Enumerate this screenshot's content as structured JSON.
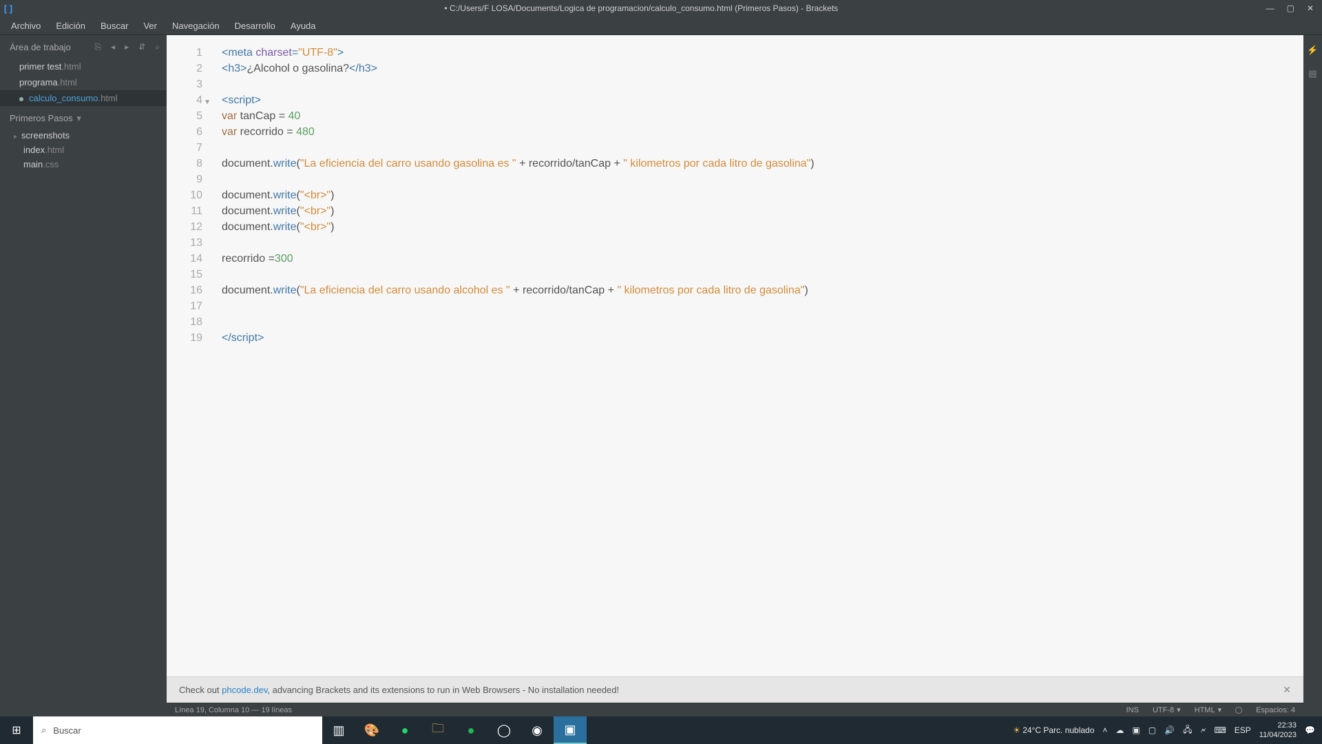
{
  "window": {
    "title": "• C:/Users/F LOSA/Documents/Logica de programacion/calculo_consumo.html (Primeros Pasos) - Brackets"
  },
  "menu": {
    "items": [
      "Archivo",
      "Edición",
      "Buscar",
      "Ver",
      "Navegación",
      "Desarrollo",
      "Ayuda"
    ]
  },
  "sidebar": {
    "workarea_label": "Área de trabajo",
    "files": [
      {
        "name": "primer test",
        "ext": ".html",
        "active": false,
        "dirty": false
      },
      {
        "name": "programa",
        "ext": ".html",
        "active": false,
        "dirty": false
      },
      {
        "name": "calculo_consumo",
        "ext": ".html",
        "active": true,
        "dirty": true
      }
    ],
    "project_name": "Primeros Pasos",
    "tree": [
      {
        "type": "folder",
        "name": "screenshots"
      },
      {
        "type": "file",
        "name": "index",
        "ext": ".html"
      },
      {
        "type": "file",
        "name": "main",
        "ext": ".css"
      }
    ]
  },
  "code": {
    "lines": [
      {
        "n": 1,
        "tokens": [
          [
            "t-tag",
            "<meta "
          ],
          [
            "t-attr",
            "charset"
          ],
          [
            "t-tag",
            "="
          ],
          [
            "t-str",
            "\"UTF-8\""
          ],
          [
            "t-tag",
            ">"
          ]
        ]
      },
      {
        "n": 2,
        "tokens": [
          [
            "t-tag",
            "<h3>"
          ],
          [
            "t-plain",
            "¿Alcohol o gasolina?"
          ],
          [
            "t-tag",
            "</h3>"
          ]
        ]
      },
      {
        "n": 3,
        "tokens": []
      },
      {
        "n": 4,
        "fold": true,
        "tokens": [
          [
            "t-tag",
            "<script>"
          ]
        ]
      },
      {
        "n": 5,
        "tokens": [
          [
            "t-key",
            "var"
          ],
          [
            "t-plain",
            " tanCap "
          ],
          [
            "t-op",
            "="
          ],
          [
            "t-plain",
            " "
          ],
          [
            "t-num",
            "40"
          ]
        ]
      },
      {
        "n": 6,
        "tokens": [
          [
            "t-key",
            "var"
          ],
          [
            "t-plain",
            " recorrido "
          ],
          [
            "t-op",
            "="
          ],
          [
            "t-plain",
            " "
          ],
          [
            "t-num",
            "480"
          ]
        ]
      },
      {
        "n": 7,
        "tokens": []
      },
      {
        "n": 8,
        "tokens": [
          [
            "t-plain",
            "document"
          ],
          [
            "t-op",
            "."
          ],
          [
            "t-func",
            "write"
          ],
          [
            "t-plain",
            "("
          ],
          [
            "t-str",
            "\"La eficiencia del carro usando gasolina es \""
          ],
          [
            "t-plain",
            " "
          ],
          [
            "t-op",
            "+"
          ],
          [
            "t-plain",
            " recorrido"
          ],
          [
            "t-op",
            "/"
          ],
          [
            "t-plain",
            "tanCap "
          ],
          [
            "t-op",
            "+"
          ],
          [
            "t-plain",
            " "
          ],
          [
            "t-str",
            "\" kilometros por cada litro de gasolina\""
          ],
          [
            "t-plain",
            ")"
          ]
        ]
      },
      {
        "n": 9,
        "tokens": []
      },
      {
        "n": 10,
        "tokens": [
          [
            "t-plain",
            "document"
          ],
          [
            "t-op",
            "."
          ],
          [
            "t-func",
            "write"
          ],
          [
            "t-plain",
            "("
          ],
          [
            "t-str",
            "\"<br>\""
          ],
          [
            "t-plain",
            ")"
          ]
        ]
      },
      {
        "n": 11,
        "tokens": [
          [
            "t-plain",
            "document"
          ],
          [
            "t-op",
            "."
          ],
          [
            "t-func",
            "write"
          ],
          [
            "t-plain",
            "("
          ],
          [
            "t-str",
            "\"<br>\""
          ],
          [
            "t-plain",
            ")"
          ]
        ]
      },
      {
        "n": 12,
        "tokens": [
          [
            "t-plain",
            "document"
          ],
          [
            "t-op",
            "."
          ],
          [
            "t-func",
            "write"
          ],
          [
            "t-plain",
            "("
          ],
          [
            "t-str",
            "\"<br>\""
          ],
          [
            "t-plain",
            ")"
          ]
        ]
      },
      {
        "n": 13,
        "tokens": []
      },
      {
        "n": 14,
        "tokens": [
          [
            "t-plain",
            "recorrido "
          ],
          [
            "t-op",
            "="
          ],
          [
            "t-num",
            "300"
          ]
        ]
      },
      {
        "n": 15,
        "tokens": []
      },
      {
        "n": 16,
        "tokens": [
          [
            "t-plain",
            "document"
          ],
          [
            "t-op",
            "."
          ],
          [
            "t-func",
            "write"
          ],
          [
            "t-plain",
            "("
          ],
          [
            "t-str",
            "\"La eficiencia del carro usando alcohol es \""
          ],
          [
            "t-plain",
            " "
          ],
          [
            "t-op",
            "+"
          ],
          [
            "t-plain",
            " recorrido"
          ],
          [
            "t-op",
            "/"
          ],
          [
            "t-plain",
            "tanCap "
          ],
          [
            "t-op",
            "+"
          ],
          [
            "t-plain",
            " "
          ],
          [
            "t-str",
            "\" kilometros por cada litro de gasolina\""
          ],
          [
            "t-plain",
            ")"
          ]
        ]
      },
      {
        "n": 17,
        "tokens": []
      },
      {
        "n": 18,
        "tokens": []
      },
      {
        "n": 19,
        "tokens": [
          [
            "t-tag",
            "<"
          ],
          [
            "t-tag",
            "/script"
          ],
          [
            "t-tag",
            ">"
          ]
        ]
      }
    ]
  },
  "notification": {
    "prefix": "Check out ",
    "link": "phcode.dev",
    "suffix": ", advancing Brackets and its extensions to run in Web Browsers - No installation needed!"
  },
  "status": {
    "cursor": "Línea 19, Columna 10 — 19 líneas",
    "ins": "INS",
    "encoding": "UTF-8",
    "lang": "HTML",
    "spaces": "Espacios: 4"
  },
  "taskbar": {
    "search_placeholder": "Buscar",
    "weather": "24°C  Parc. nublado",
    "lang": "ESP",
    "time": "22:33",
    "date": "11/04/2023"
  }
}
